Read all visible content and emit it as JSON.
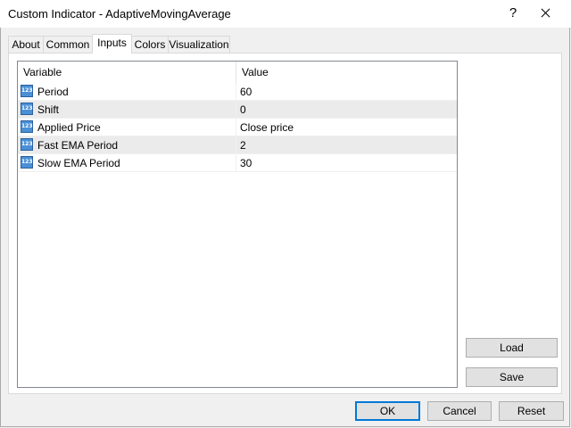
{
  "window": {
    "title": "Custom Indicator - AdaptiveMovingAverage",
    "help_label": "?"
  },
  "tabs": [
    {
      "label": "About"
    },
    {
      "label": "Common"
    },
    {
      "label": "Inputs"
    },
    {
      "label": "Colors"
    },
    {
      "label": "Visualization"
    }
  ],
  "active_tab": "Inputs",
  "table": {
    "columns": [
      "Variable",
      "Value"
    ],
    "rows": [
      {
        "variable": "Period",
        "value": "60",
        "icon": "123-icon"
      },
      {
        "variable": "Shift",
        "value": "0",
        "icon": "123-icon"
      },
      {
        "variable": "Applied Price",
        "value": "Close price",
        "icon": "123-icon"
      },
      {
        "variable": "Fast EMA Period",
        "value": "2",
        "icon": "123-icon"
      },
      {
        "variable": "Slow EMA Period",
        "value": "30",
        "icon": "123-icon"
      }
    ]
  },
  "side_buttons": {
    "load": "Load",
    "save": "Save"
  },
  "footer_buttons": {
    "ok": "OK",
    "cancel": "Cancel",
    "reset": "Reset"
  }
}
